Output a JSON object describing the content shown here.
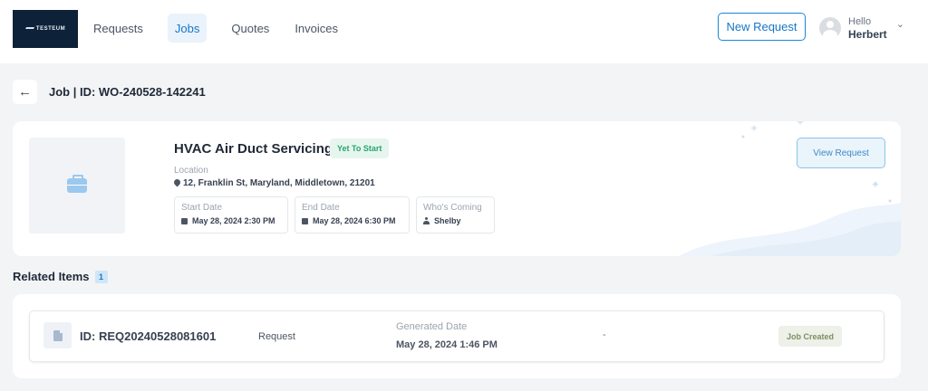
{
  "header": {
    "logo_text": "TESTEUM",
    "nav": [
      {
        "label": "Requests",
        "active": false
      },
      {
        "label": "Jobs",
        "active": true
      },
      {
        "label": "Quotes",
        "active": false
      },
      {
        "label": "Invoices",
        "active": false
      }
    ],
    "new_request_label": "New Request",
    "user": {
      "greeting": "Hello",
      "name": "Herbert"
    }
  },
  "page": {
    "title": "Job | ID: WO-240528-142241"
  },
  "job": {
    "title": "HVAC Air Duct Servicing",
    "status": "Yet To Start",
    "location_label": "Location",
    "location": "12, Franklin St, Maryland, Middletown, 21201",
    "start_label": "Start Date",
    "start_value": "May 28, 2024 2:30 PM",
    "end_label": "End Date",
    "end_value": "May 28, 2024 6:30 PM",
    "who_label": "Who's Coming",
    "who_value": "Shelby",
    "view_request_label": "View Request"
  },
  "related": {
    "title": "Related Items",
    "count": "1",
    "items": [
      {
        "id": "ID: REQ20240528081601",
        "type": "Request",
        "generated_label": "Generated Date",
        "generated_date": "May 28, 2024 1:46 PM",
        "extra": "-",
        "status": "Job Created"
      }
    ]
  },
  "colors": {
    "accent": "#1577c7",
    "status_green": "#2aa56d",
    "logo_bg": "#0d2238"
  }
}
